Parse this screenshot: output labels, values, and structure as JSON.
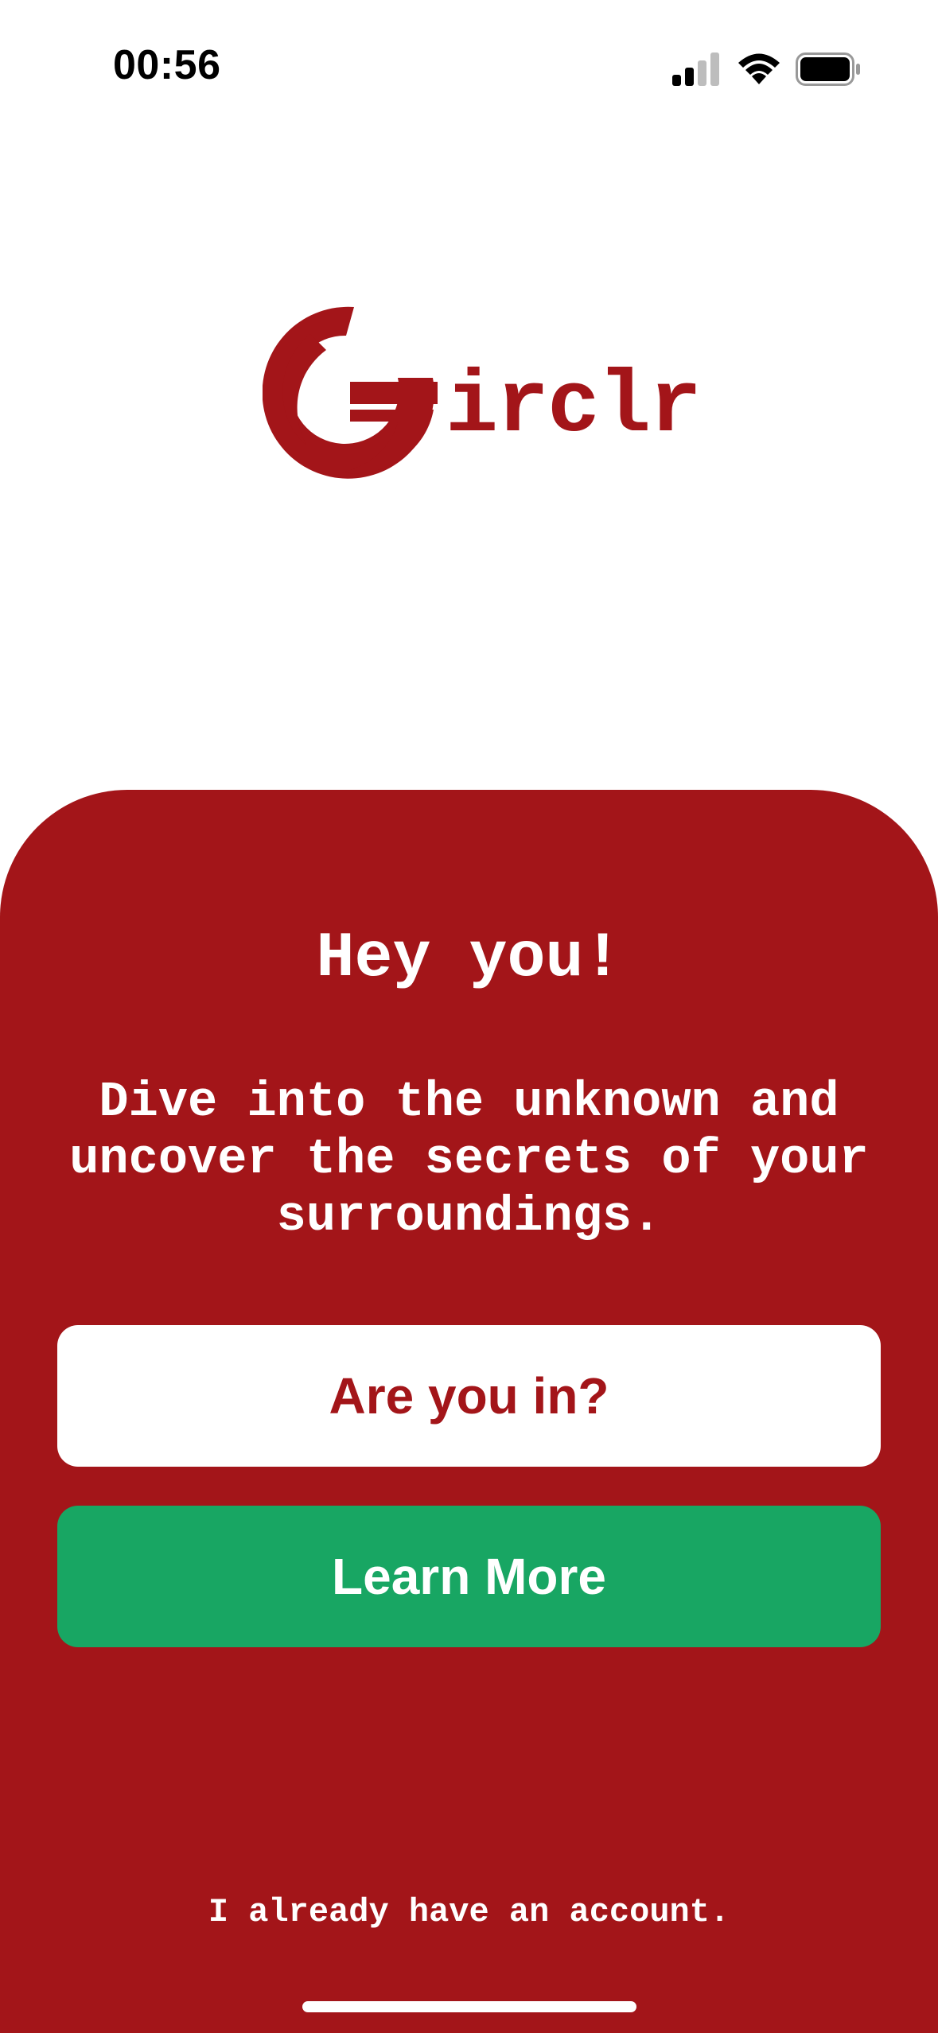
{
  "status_bar": {
    "time": "00:56",
    "icons": [
      "signal-icon",
      "wifi-icon",
      "battery-icon"
    ]
  },
  "logo": {
    "text": "irclr",
    "icon": "circle-swoosh-logo",
    "color": "#a31519"
  },
  "welcome": {
    "headline": "Hey you!",
    "tagline": "Dive into the unknown and uncover the secrets of your surroundings."
  },
  "actions": {
    "primary_label": "Are you in?",
    "secondary_label": "Learn More",
    "login_link": "I already have an account."
  },
  "colors": {
    "brand_red": "#a31519",
    "accent_green": "#18a663",
    "white": "#ffffff"
  }
}
